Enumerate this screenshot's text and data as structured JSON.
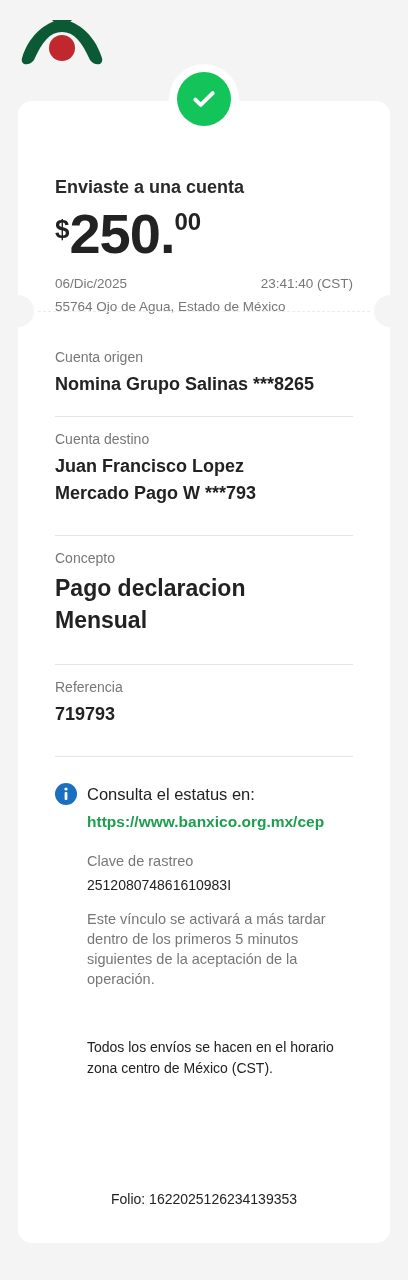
{
  "receipt": {
    "title": "Enviaste a una cuenta",
    "amount": {
      "currency": "$",
      "integer": "250.",
      "cents": "00"
    },
    "date": "06/Dic/2025",
    "time": "23:41:40 (CST)",
    "location": "55764 Ojo de Agua, Estado de México"
  },
  "details": [
    {
      "label": "Cuenta origen",
      "lines": [
        "Nomina Grupo Salinas ***8265"
      ],
      "kind": "account",
      "divider": false
    },
    {
      "label": "Cuenta destino",
      "lines": [
        "Juan Francisco Lopez",
        "Mercado Pago W ***793"
      ],
      "kind": "account",
      "divider": true
    },
    {
      "label": "Concepto",
      "lines": [
        "Pago declaracion",
        "Mensual"
      ],
      "kind": "large",
      "divider": true
    },
    {
      "label": "Referencia",
      "lines": [
        "719793"
      ],
      "kind": "account",
      "divider": true
    }
  ],
  "info": {
    "heading": "Consulta el estatus en:",
    "link": "https://www.banxico.org.mx/cep",
    "tracking_label": "Clave de rastreo",
    "tracking_value": "251208074861610983I",
    "disclaimer": "Este vínculo se activará a más tardar dentro de los primeros 5 minutos siguientes de la aceptación de la operación."
  },
  "note": "Todos los envíos se hacen en el horario zona centro de México (CST).",
  "folio": "Folio: 1622025126234139353"
}
